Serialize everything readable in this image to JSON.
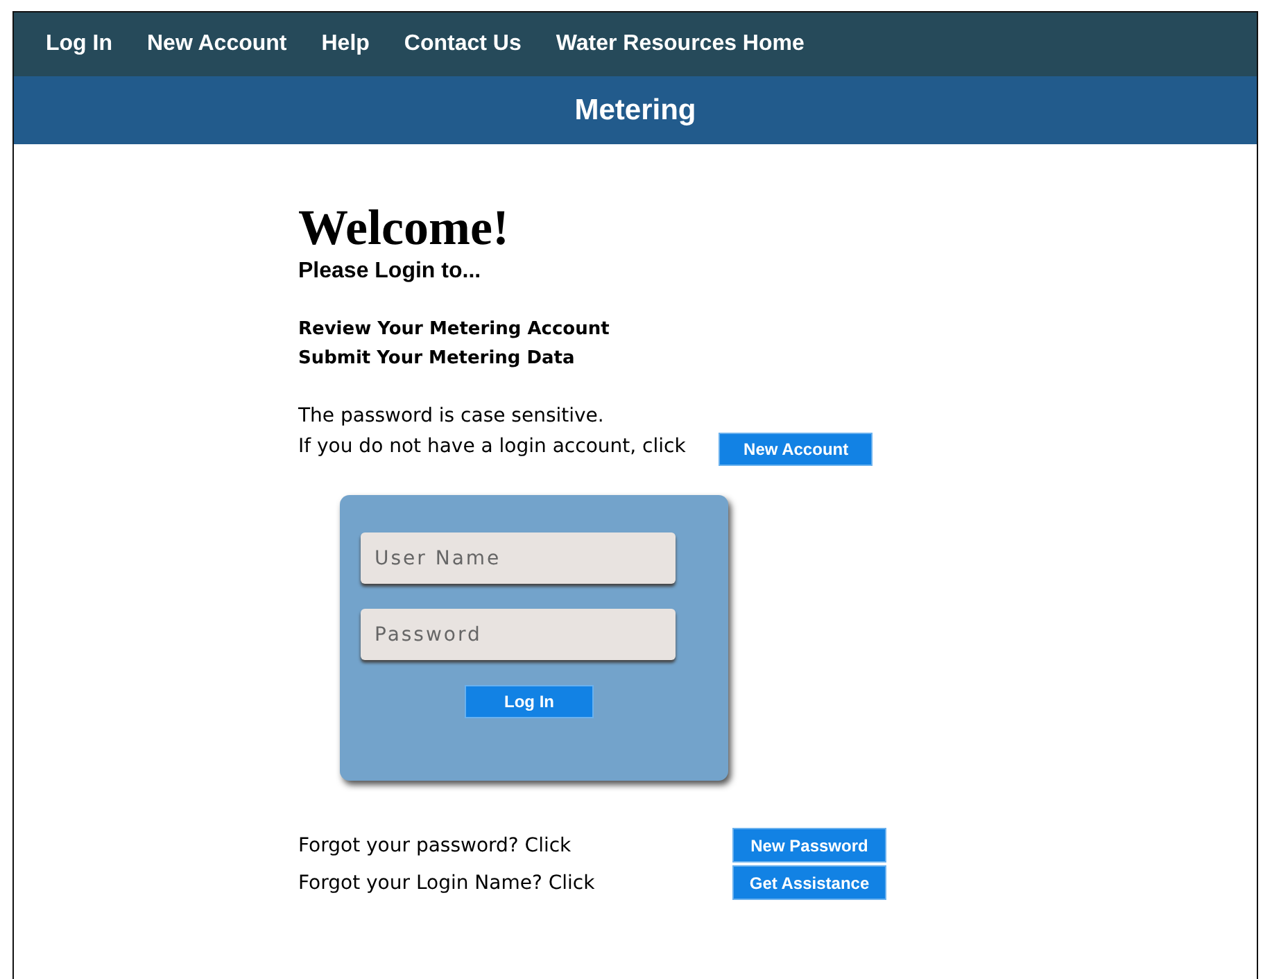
{
  "nav": [
    "Log In",
    "New Account",
    "Help",
    "Contact Us",
    "Water Resources Home"
  ],
  "title": "Metering",
  "heading": "Welcome!",
  "subheading": "Please Login to...",
  "purposes": [
    "Review Your Metering Account",
    "Submit Your Metering Data"
  ],
  "note": "The password is case sensitive.",
  "new_account": {
    "text": "If you do not have a login account, click",
    "button": "New Account"
  },
  "login": {
    "fields": [
      {
        "placeholder": "User Name"
      },
      {
        "placeholder": "Password"
      }
    ],
    "button": "Log In"
  },
  "help_rows": [
    {
      "text": "Forgot your password? Click",
      "button": "New Password"
    },
    {
      "text": "Forgot your Login Name? Click",
      "button": "Get Assistance"
    }
  ]
}
